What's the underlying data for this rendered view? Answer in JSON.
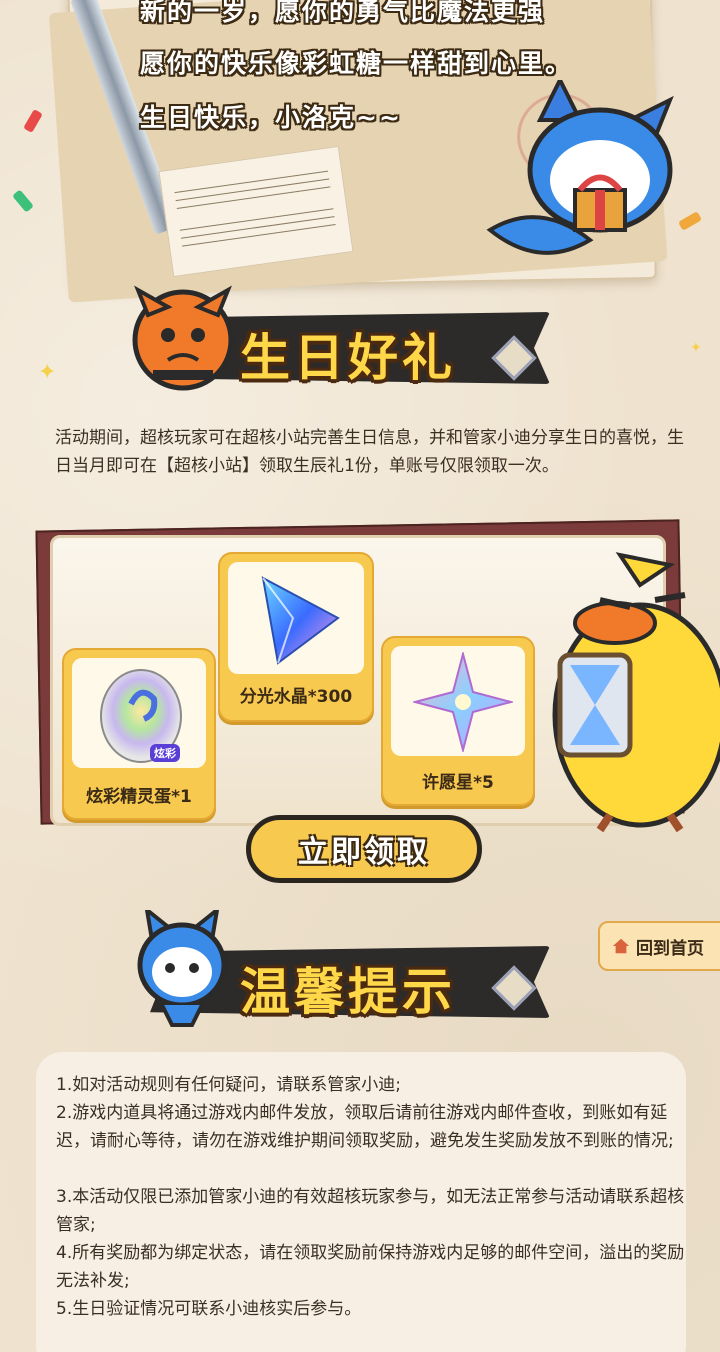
{
  "letter": {
    "line1": "新的一岁，愿你的勇气比魔法更强",
    "line2": "愿你的快乐像彩虹糖一样甜到心里。",
    "line3": "生日快乐，小洛克~~"
  },
  "gift_section": {
    "title": "生日好礼",
    "description": "活动期间，超核玩家可在超核小站完善生日信息，并和管家小迪分享生日的喜悦，生日当月即可在【超核小站】领取生辰礼1份，单账号仅限领取一次。",
    "items": [
      {
        "name": "炫彩精灵蛋*1",
        "badge": "炫彩",
        "icon": "rainbow-egg-icon"
      },
      {
        "name": "分光水晶*300",
        "icon": "prism-crystal-icon"
      },
      {
        "name": "许愿星*5",
        "icon": "wish-star-icon"
      }
    ],
    "claim_label": "立即领取"
  },
  "home_button": {
    "label": "回到首页",
    "icon": "home-icon"
  },
  "tips_section": {
    "title": "温馨提示",
    "items": [
      "1.如对活动规则有任何疑问，请联系管家小迪;",
      "2.游戏内道具将通过游戏内邮件发放，领取后请前往游戏内邮件查收，到账如有延迟，请耐心等待，请勿在游戏维护期间领取奖励，避免发生奖励发放不到账的情况;",
      "3.本活动仅限已添加管家小迪的有效超核玩家参与，如无法正常参与活动请联系超核管家;",
      "4.所有奖励都为绑定状态，请在领取奖励前保持游戏内足够的邮件空间，溢出的奖励无法补发;",
      "5.生日验证情况可联系小迪核实后参与。"
    ]
  },
  "colors": {
    "accent": "#ffd84a",
    "button": "#f8c94f",
    "banner": "#2c2b2a",
    "background": "#efe3cf"
  }
}
